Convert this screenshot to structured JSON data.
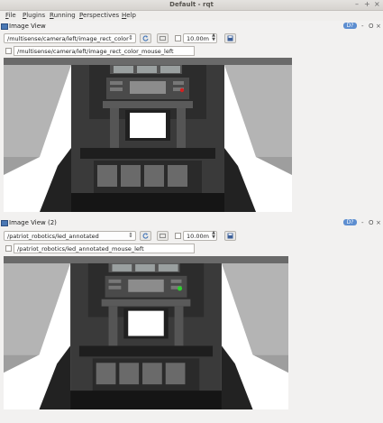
{
  "window": {
    "title": "Default - rqt",
    "controls": [
      "–",
      "+",
      "×"
    ]
  },
  "menu": [
    {
      "label": "File",
      "mnemonic": "F",
      "rest": "ile"
    },
    {
      "label": "Plugins",
      "mnemonic": "P",
      "rest": "lugins"
    },
    {
      "label": "Running",
      "mnemonic": "R",
      "rest": "unning"
    },
    {
      "label": "Perspectives",
      "mnemonic": "P",
      "rest": "erspectives"
    },
    {
      "label": "Help",
      "mnemonic": "H",
      "rest": "elp"
    }
  ],
  "panel_controls": {
    "d": "D",
    "help": "?",
    "minimize": "-",
    "undock": "O",
    "close": "×"
  },
  "panels": [
    {
      "title": "Image View",
      "topic": "/multisense/camera/left/image_rect_color",
      "zoom": "10.00m",
      "mouse_topic": "/multisense/camera/left/image_rect_color_mouse_left",
      "led_color": "#d42020"
    },
    {
      "title": "Image View (2)",
      "topic": "/patriot_robotics/led_annotated",
      "zoom": "10.00m",
      "mouse_topic": "/patriot_robotics/led_annotated_mouse_left",
      "led_color": "#2ed02e"
    }
  ],
  "icons": {
    "refresh": "refresh-icon",
    "fit": "fit-icon",
    "save": "save-icon"
  }
}
